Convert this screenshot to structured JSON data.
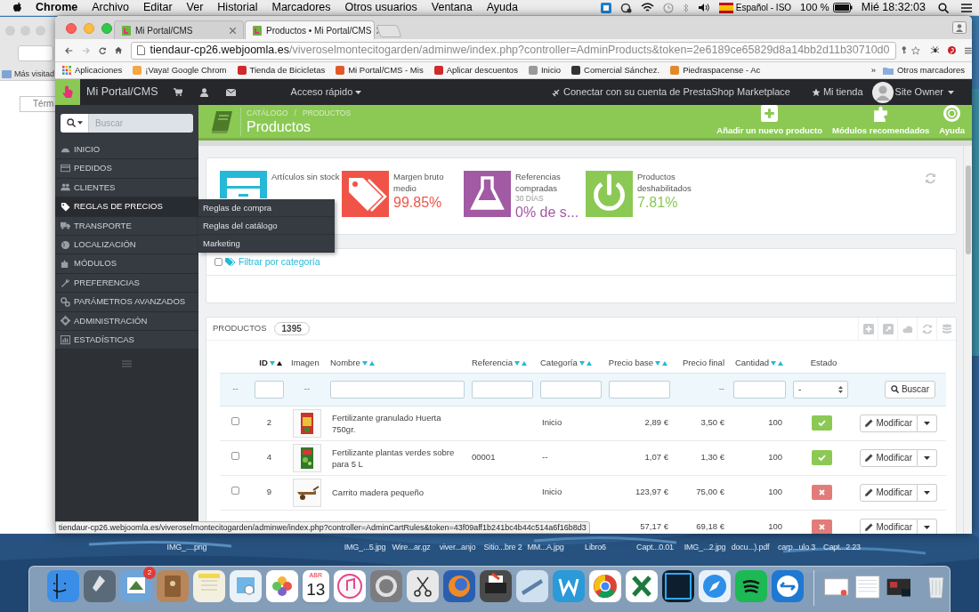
{
  "menubar": {
    "app": "Chrome",
    "menus": [
      "Archivo",
      "Editar",
      "Ver",
      "Historial",
      "Marcadores",
      "Otros usuarios",
      "Ventana",
      "Ayuda"
    ],
    "input_source": "Español - ISO",
    "battery": "100 %",
    "clock": "Mié 18:32:03"
  },
  "background_window": {
    "bookmark": "Más visitad",
    "field_value": "Térm"
  },
  "browser": {
    "tabs": [
      {
        "label": "Mi Portal/CMS",
        "selected": false
      },
      {
        "label": "Productos • Mi Portal/CMS",
        "selected": true
      }
    ],
    "url": {
      "host": "tiendaur-cp26.webjoomla.es",
      "path": "/viveroselmontecitogarden/adminwe/index.php?controller=AdminProducts&token=2e6189ce65829d8a14bb2d11b30710d0"
    },
    "bookmarks": [
      "Aplicaciones",
      "¡Vaya! Google Chrom",
      "Tienda de Bicicletas",
      "Mi Portal/CMS - Mis",
      "Aplicar descuentos",
      "Inicio",
      "Comercial Sánchez.",
      "Piedraspacense - Ac"
    ],
    "more_bookmarks": "»",
    "other_bookmarks": "Otros marcadores",
    "status_url": "tiendaur-cp26.webjoomla.es/viveroselmontecitogarden/adminwe/index.php?controller=AdminCartRules&token=43f09aff1b241bc4b44c514a6f16b8d3"
  },
  "admin_bar": {
    "brand": "Mi Portal/CMS",
    "quick_access": "Acceso rápido",
    "marketplace": "Conectar con su cuenta de PrestaShop Marketplace",
    "shop": "Mi tienda",
    "user": "Site Owner"
  },
  "sidebar": {
    "search_placeholder": "Buscar",
    "items": [
      {
        "label": "INICIO",
        "selected": false
      },
      {
        "label": "PEDIDOS",
        "selected": false
      },
      {
        "label": "CLIENTES",
        "selected": false
      },
      {
        "label": "REGLAS DE PRECIOS",
        "selected": true
      },
      {
        "label": "TRANSPORTE",
        "selected": false
      },
      {
        "label": "LOCALIZACIÓN",
        "selected": false
      },
      {
        "label": "MÓDULOS",
        "selected": false
      },
      {
        "label": "PREFERENCIAS",
        "selected": false
      },
      {
        "label": "PARÁMETROS AVANZADOS",
        "selected": false
      },
      {
        "label": "ADMINISTRACIÓN",
        "selected": false
      },
      {
        "label": "ESTADÍSTICAS",
        "selected": false
      }
    ],
    "submenu": [
      "Reglas de compra",
      "Reglas del catálogo",
      "Marketing"
    ]
  },
  "page_header": {
    "breadcrumb": [
      "CATÁLOGO",
      "PRODUCTOS"
    ],
    "separator": "/",
    "title": "Productos",
    "actions": [
      "Añadir un nuevo producto",
      "Módulos recomendados",
      "Ayuda"
    ]
  },
  "kpis": [
    {
      "label": "Artículos sin stock",
      "color": "#25b9d7"
    },
    {
      "label": "Margen bruto medio",
      "value": "99.85%",
      "color": "#f05448"
    },
    {
      "label": "Referencias compradas",
      "sub": "30 DÍAS",
      "value": "0% de s...",
      "color": "#a15aa3"
    },
    {
      "label": "Productos deshabilitados",
      "value": "7.81%",
      "color": "#8bc954"
    }
  ],
  "category_filter": {
    "label": "Filtrar por categoría",
    "checked": false
  },
  "products": {
    "title": "PRODUCTOS",
    "count": "1395",
    "columns": [
      {
        "label": "ID",
        "sortable": true,
        "sorted": true
      },
      {
        "label": "Imagen",
        "sortable": false,
        "sorted": false
      },
      {
        "label": "Nombre",
        "sortable": true,
        "sorted": false
      },
      {
        "label": "Referencia",
        "sortable": true,
        "sorted": false
      },
      {
        "label": "Categoría",
        "sortable": true,
        "sorted": false
      },
      {
        "label": "Precio base",
        "sortable": true,
        "sorted": false
      },
      {
        "label": "Precio final",
        "sortable": false,
        "sorted": false
      },
      {
        "label": "Cantidad",
        "sortable": true,
        "sorted": false
      },
      {
        "label": "Estado",
        "sortable": false,
        "sorted": false
      }
    ],
    "filters": [
      {
        "kind": "dash",
        "text": "--"
      },
      {
        "kind": "input"
      },
      {
        "kind": "dash",
        "text": "--"
      },
      {
        "kind": "input"
      },
      {
        "kind": "input"
      },
      {
        "kind": "input"
      },
      {
        "kind": "input"
      },
      {
        "kind": "dash",
        "text": "--"
      },
      {
        "kind": "input"
      },
      {
        "kind": "select",
        "value": "-"
      },
      {
        "kind": "button",
        "text": "Buscar"
      }
    ],
    "rows": [
      {
        "checked": false,
        "id": "2",
        "name": "Fertilizante granulado Huerta 750gr.",
        "category": "Inicio",
        "base_price": "2,89 €",
        "final_price": "3,50 €",
        "quantity": "100",
        "enabled": true,
        "action": "Modificar"
      },
      {
        "checked": false,
        "id": "4",
        "name": "Fertilizante plantas verdes sobre para 5 L",
        "reference": "00001",
        "category": "--",
        "base_price": "1,07 €",
        "final_price": "1,30 €",
        "quantity": "100",
        "enabled": true,
        "action": "Modificar"
      },
      {
        "checked": false,
        "id": "9",
        "name": "Carrito madera pequeño",
        "category": "Inicio",
        "base_price": "123,97 €",
        "final_price": "75,00 €",
        "quantity": "100",
        "enabled": false,
        "action": "Modificar"
      },
      {
        "base_price": "57,17 €",
        "final_price": "69,18 €",
        "quantity": "100",
        "enabled": false,
        "action": "Modificar"
      }
    ]
  },
  "desktop_files": [
    "IMG_....png",
    "IMG_...5.jpg",
    "Wire...ar.gz",
    "viver...anjo",
    "Sitio...bre 2",
    "MM...A.jpg",
    "Libro6",
    "Capt...0.01",
    "IMG_...2.jpg",
    "docu...).pdf",
    "carp...ulo 3",
    "Capt...2.23"
  ],
  "dock": {
    "badge": "2",
    "calendar_month": "ABR",
    "calendar_day": "13"
  }
}
